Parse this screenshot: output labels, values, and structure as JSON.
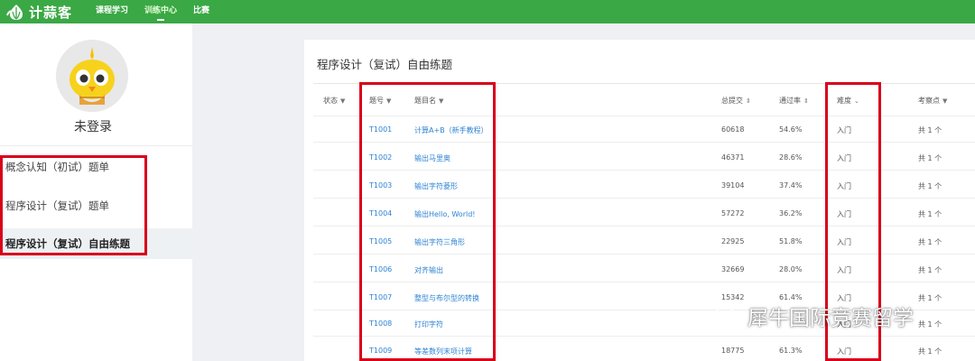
{
  "header": {
    "logo_text": "计蒜客",
    "nav": [
      {
        "label": "课程学习"
      },
      {
        "label": "训练中心",
        "active": true
      },
      {
        "label": "比赛"
      }
    ],
    "bg_color": "#3aa845"
  },
  "sidebar": {
    "login_label": "未登录",
    "menu": [
      {
        "label": "概念认知（初试）题单"
      },
      {
        "label": "程序设计（复试）题单"
      },
      {
        "label": "程序设计（复试）自由练题",
        "active": true
      }
    ]
  },
  "main": {
    "title": "程序设计（复试）自由练题",
    "columns": [
      {
        "label": "状态",
        "caret": "▼"
      },
      {
        "label": "题号",
        "caret": "▼"
      },
      {
        "label": "题目名",
        "caret": "▼"
      },
      {
        "label": "总提交",
        "caret": "⇕"
      },
      {
        "label": "通过率",
        "caret": "⇕"
      },
      {
        "label": "难度",
        "caret": "⌄"
      },
      {
        "label": "考察点",
        "caret": "▼"
      }
    ],
    "rows": [
      {
        "id": "T1001",
        "name": "计算A+B（新手教程）",
        "submissions": "60618",
        "pass_rate": "54.6%",
        "difficulty": "入门",
        "points": "共 1 个"
      },
      {
        "id": "T1002",
        "name": "输出马里奥",
        "submissions": "46371",
        "pass_rate": "28.6%",
        "difficulty": "入门",
        "points": "共 1 个"
      },
      {
        "id": "T1003",
        "name": "输出字符菱形",
        "submissions": "39104",
        "pass_rate": "37.4%",
        "difficulty": "入门",
        "points": "共 1 个"
      },
      {
        "id": "T1004",
        "name": "输出Hello, World!",
        "submissions": "57272",
        "pass_rate": "36.2%",
        "difficulty": "入门",
        "points": "共 1 个"
      },
      {
        "id": "T1005",
        "name": "输出字符三角形",
        "submissions": "22925",
        "pass_rate": "51.8%",
        "difficulty": "入门",
        "points": "共 1 个"
      },
      {
        "id": "T1006",
        "name": "对齐输出",
        "submissions": "32669",
        "pass_rate": "28.0%",
        "difficulty": "入门",
        "points": "共 1 个"
      },
      {
        "id": "T1007",
        "name": "整型与布尔型的转换",
        "submissions": "15342",
        "pass_rate": "61.4%",
        "difficulty": "入门",
        "points": "共 1 个"
      },
      {
        "id": "T1008",
        "name": "打印字符",
        "submissions": "",
        "pass_rate": "",
        "difficulty": "入门",
        "points": "共 1 个"
      },
      {
        "id": "T1009",
        "name": "等差数列末项计算",
        "submissions": "18775",
        "pass_rate": "61.3%",
        "difficulty": "入门",
        "points": "共 1 个"
      }
    ]
  },
  "watermark": {
    "text": "犀牛国际竞赛留学",
    "icon": "wechat-icon"
  },
  "colors": {
    "accent": "#3aa845",
    "link": "#2e83d3",
    "annotation": "#d9001b"
  }
}
